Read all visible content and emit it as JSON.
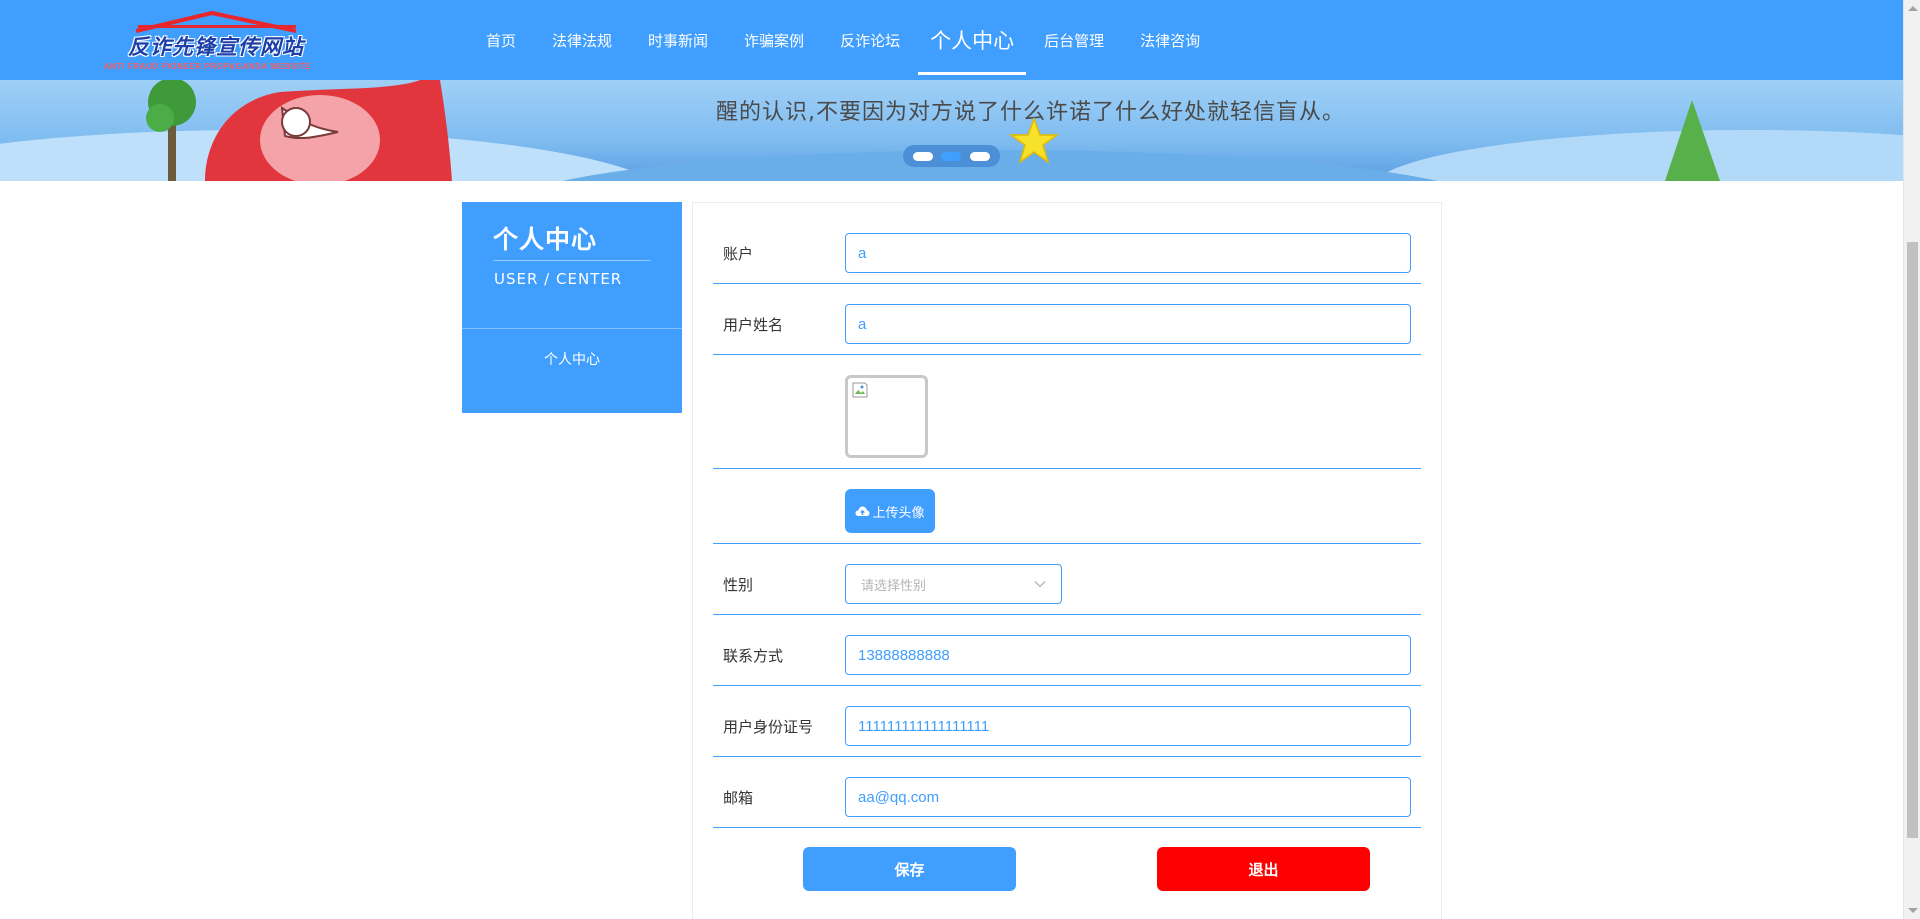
{
  "header": {
    "logo_title": "反诈先锋宣传网站",
    "logo_subtitle": "ANTI FRAUD PIONEER PROPAGANDA WEBSITE",
    "nav": [
      {
        "label": "首页"
      },
      {
        "label": "法律法规"
      },
      {
        "label": "时事新闻"
      },
      {
        "label": "诈骗案例"
      },
      {
        "label": "反诈论坛"
      },
      {
        "label": "个人中心",
        "active": true
      },
      {
        "label": "后台管理"
      },
      {
        "label": "法律咨询"
      }
    ]
  },
  "banner": {
    "text": "醒的认识,不要因为对方说了什么许诺了什么好处就轻信盲从。",
    "slide_count": 3,
    "active_slide": 2
  },
  "sidebar": {
    "title": "个人中心",
    "subtitle": "USER / CENTER",
    "items": [
      {
        "label": "个人中心"
      }
    ]
  },
  "form": {
    "account": {
      "label": "账户",
      "value": "a"
    },
    "name": {
      "label": "用户姓名",
      "value": "a"
    },
    "avatar": {
      "icon": "broken-image-icon"
    },
    "upload": {
      "label": "上传头像",
      "icon": "cloud-upload-icon"
    },
    "gender": {
      "label": "性别",
      "placeholder": "请选择性别",
      "icon": "chevron-down-icon"
    },
    "phone": {
      "label": "联系方式",
      "value": "13888888888"
    },
    "id_number": {
      "label": "用户身份证号",
      "value": "111111111111111111"
    },
    "email": {
      "label": "邮箱",
      "value": "aa@qq.com"
    },
    "save_label": "保存",
    "exit_label": "退出"
  },
  "colors": {
    "primary": "#409eff",
    "danger": "#ff0000",
    "label_text": "#333333",
    "placeholder": "#b4b4b4"
  }
}
